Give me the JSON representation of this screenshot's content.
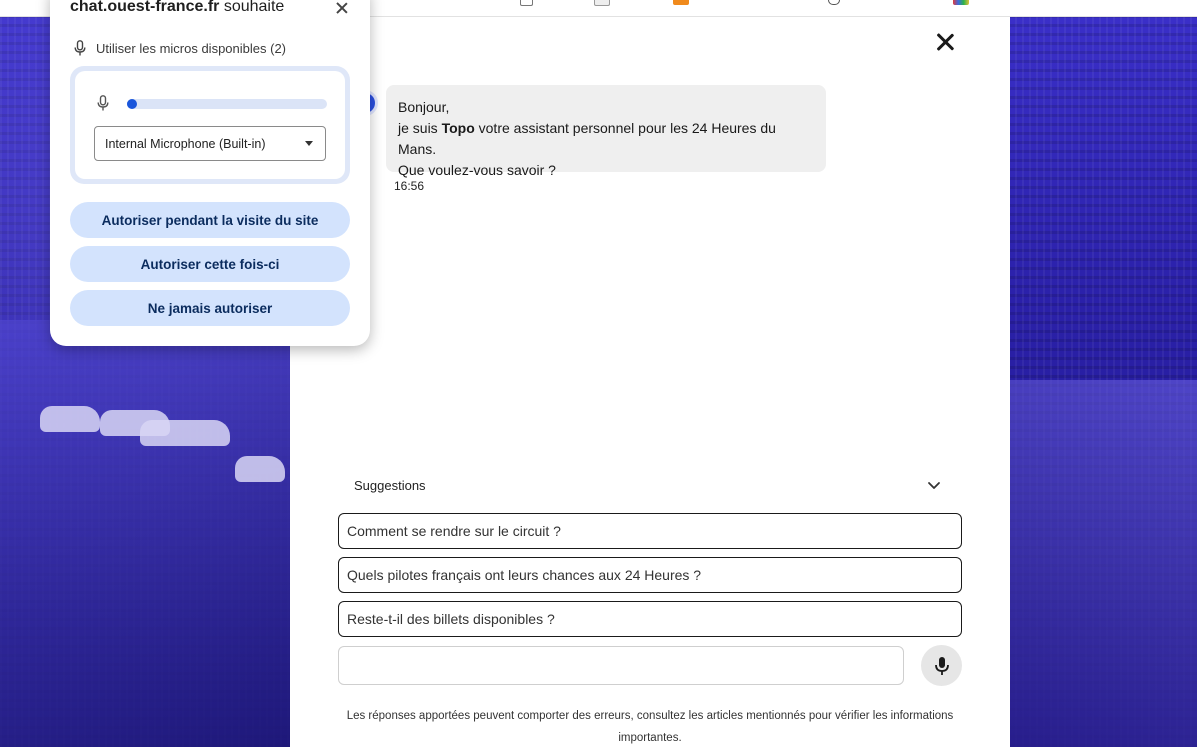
{
  "permission_prompt": {
    "title_site": "chat.ouest-france.fr",
    "title_rest": " souhaite",
    "permission_label": "Utiliser les micros disponibles (2)",
    "mic_level": 0.05,
    "selected_device": "Internal Microphone (Built-in)",
    "buttons": {
      "allow_visit": "Autoriser pendant la visite du site",
      "allow_once": "Autoriser cette fois-ci",
      "never": "Ne jamais autoriser"
    },
    "icons": [
      "microphone-icon",
      "close-icon",
      "dropdown-caret-icon"
    ]
  },
  "chat": {
    "message": {
      "line1": "Bonjour,",
      "line2_prefix": "je suis ",
      "assistant_name": "Topo",
      "line2_suffix": " votre assistant personnel pour les 24 Heures du Mans.",
      "line3": "Que voulez-vous savoir ?",
      "time": "16:56"
    },
    "suggestions_label": "Suggestions",
    "suggestions": [
      "Comment se rendre sur le circuit ?",
      "Quels pilotes français ont leurs chances aux 24 Heures ?",
      "Reste-t-il des billets disponibles ?"
    ],
    "input_value": "",
    "disclaimer": "Les réponses apportées peuvent comporter des erreurs, consultez les articles mentionnés pour vérifier les informations importantes."
  },
  "colors": {
    "background_tint": "#2a1fb0",
    "button_bg": "#d3e3fd",
    "level_fill": "#1a56db",
    "bubble_bg": "#efefef"
  }
}
